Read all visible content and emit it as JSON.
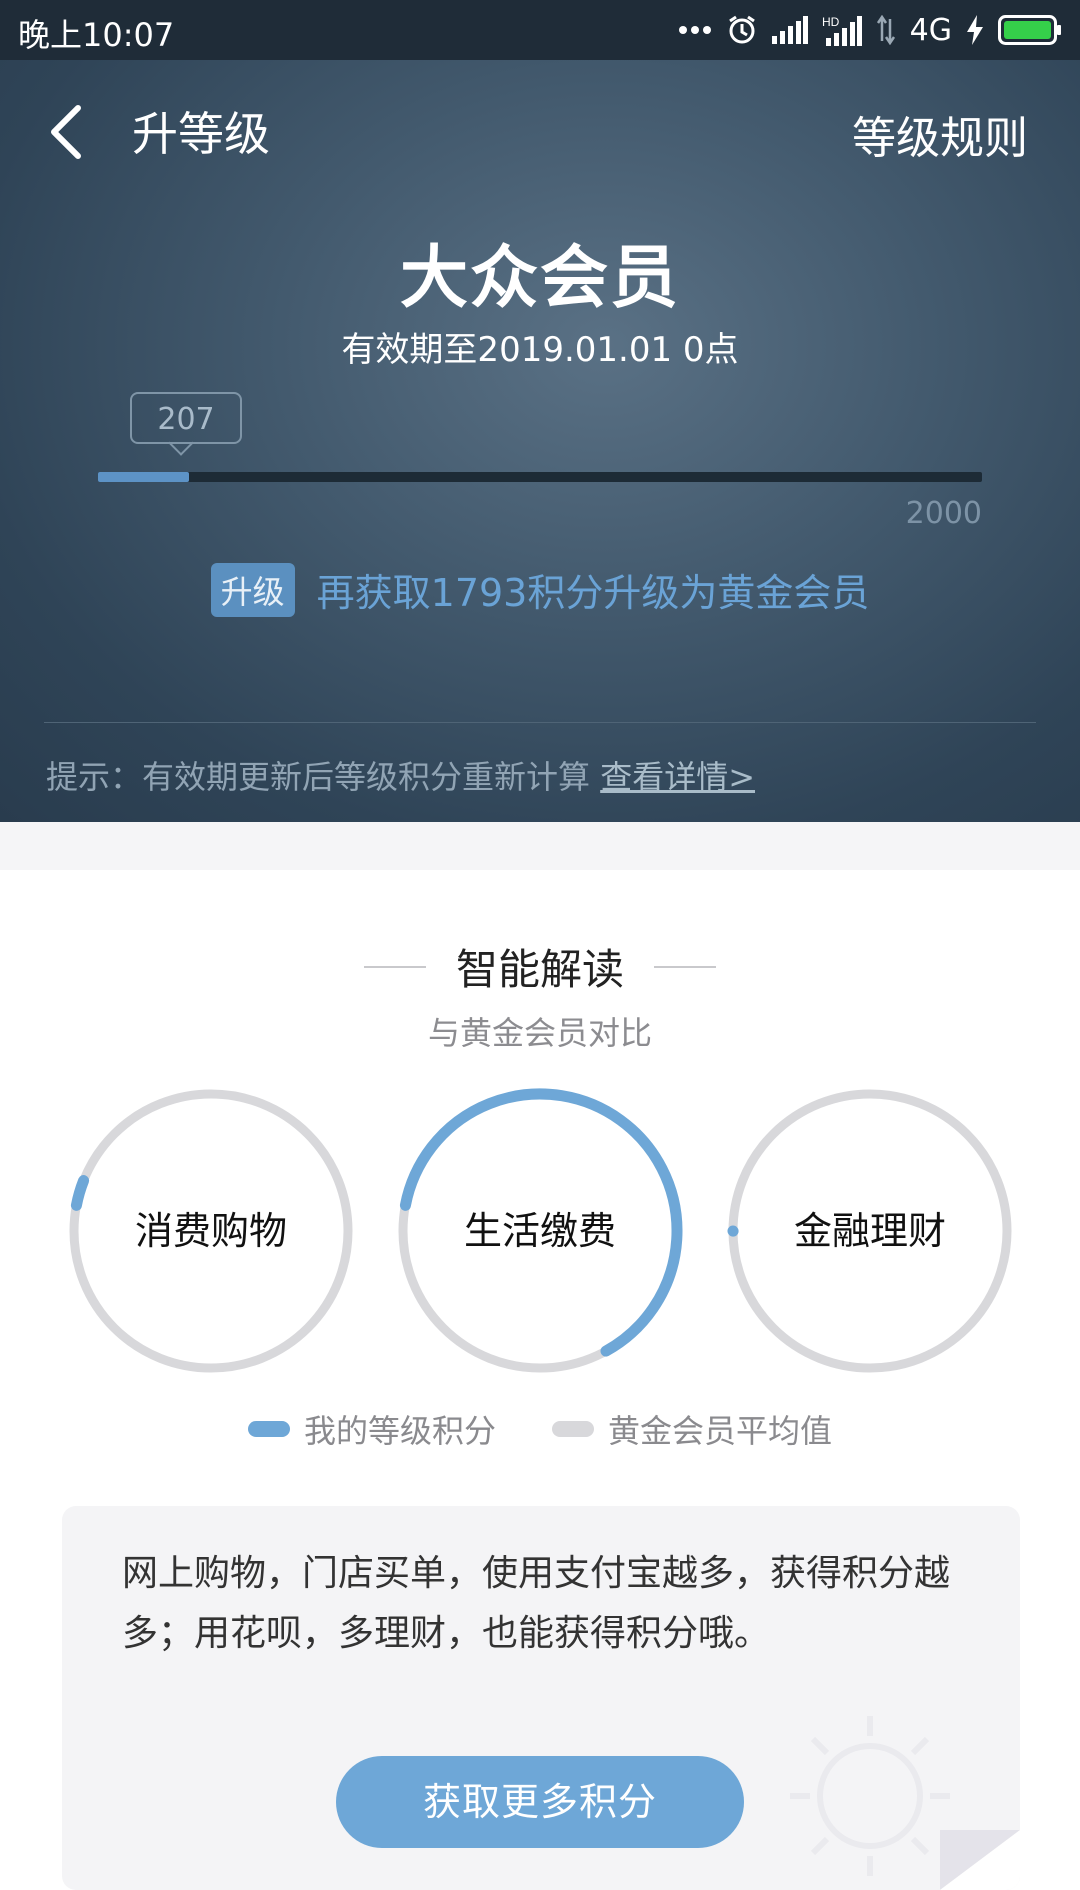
{
  "status_bar": {
    "time": "晚上10:07",
    "network": "4G",
    "hd_label": "HD"
  },
  "nav": {
    "title": "升等级",
    "rules_label": "等级规则"
  },
  "level": {
    "name": "大众会员",
    "validity": "有效期至2019.01.01 0点",
    "points_current": "207",
    "points_max": "2000",
    "progress_fraction": 0.1035,
    "upgrade_badge": "升级",
    "upgrade_text": "再获取1793积分升级为黄金会员"
  },
  "tip": {
    "text": "提示：有效期更新后等级积分重新计算 ",
    "link": "查看详情>"
  },
  "analysis": {
    "title": "智能解读",
    "subtitle": "与黄金会员对比",
    "rings": [
      {
        "label": "消费购物",
        "my_fraction": 0.03,
        "arc_start_fraction": 0.53
      },
      {
        "label": "生活缴费",
        "my_fraction": 0.64,
        "arc_start_fraction": 0.53
      },
      {
        "label": "金融理财",
        "my_fraction": 0.0,
        "arc_start_fraction": 0.5
      }
    ],
    "legend": {
      "mine": "我的等级积分",
      "gold_avg": "黄金会员平均值"
    }
  },
  "advice": {
    "text": "网上购物，门店买单，使用支付宝越多，获得积分越多；用花呗，多理财，也能获得积分哦。",
    "button": "获取更多积分"
  },
  "colors": {
    "accent": "#6ea7d7",
    "ring_gray": "#d8d8db",
    "header_dark": "#2f4457"
  }
}
